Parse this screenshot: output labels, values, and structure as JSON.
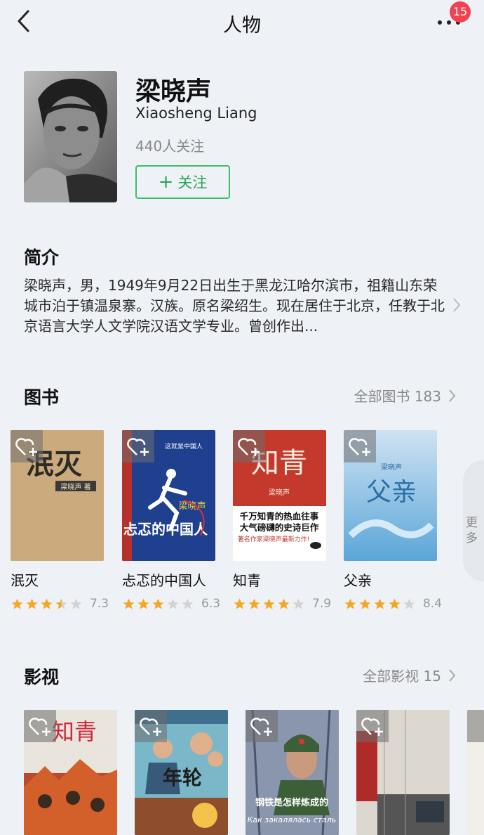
{
  "header": {
    "title": "人物",
    "notification_count": "15"
  },
  "person": {
    "name": "梁晓声",
    "name_en": "Xiaosheng Liang",
    "followers": "440人关注",
    "follow_label": "关注"
  },
  "intro": {
    "heading": "简介",
    "text": "梁晓声，男，1949年9月22日出生于黑龙江哈尔滨市，祖籍山东荣城市泊于镇温泉寨。汉族。原名梁绍生。现在居住于北京，任教于北京语言大学人文学院汉语文学专业。曾创作出..."
  },
  "books": {
    "heading": "图书",
    "all_label": "全部图书 183",
    "more_label": "更多",
    "items": [
      {
        "title": "泯灭",
        "rating": "7.3",
        "stars": 3.5,
        "cover_text": "泯灭",
        "cover_author": "梁晓声 著"
      },
      {
        "title": "忐忑的中国人",
        "rating": "6.3",
        "stars": 3,
        "cover_text": "忐忑的中国人",
        "cover_author": "梁晓声",
        "cover_top": "这就是中国人"
      },
      {
        "title": "知青",
        "rating": "7.9",
        "stars": 4,
        "cover_text": "知青",
        "cover_author": "梁晓声",
        "cover_sub1": "千万知青的热血往事",
        "cover_sub2": "大气磅礴的史诗巨作",
        "cover_sub3": "著名作家梁晓声最新力作!"
      },
      {
        "title": "父亲",
        "rating": "8.4",
        "stars": 4,
        "cover_text": "父亲",
        "cover_author": "梁晓声"
      }
    ]
  },
  "films": {
    "heading": "影视",
    "all_label": "全部影视 15",
    "items": [
      {
        "cover_text": "知青"
      },
      {
        "cover_text": "年轮"
      },
      {
        "cover_text": "钢铁是怎样炼成的",
        "cover_ru": "Как закалялась сталь"
      },
      {
        "cover_text": ""
      }
    ]
  },
  "colors": {
    "accent_green": "#3fbe6a",
    "star": "#f5a623",
    "badge": "#f0424f"
  }
}
